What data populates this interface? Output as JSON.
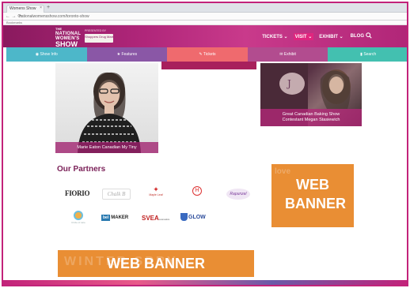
{
  "browser": {
    "tab_title": "Womens Show",
    "tab_close": "×",
    "new_tab": "+",
    "nav_arrows": "← → ⟳",
    "url": "nationalwomensshow.com/toronto-show",
    "bookmarks": "Bookmarks"
  },
  "site": {
    "logo_line1": "THE",
    "logo_line2": "NATIONAL WOMEN'S",
    "logo_line3": "SHOW",
    "sponsor_label": "PRESENTED BY",
    "sponsor_name": "Shoppers Drug Mart",
    "nav": [
      "TICKETS ⌄",
      "VISIT ⌄",
      "EXHIBIT ⌄",
      "BLOG"
    ],
    "active_nav_index": 1,
    "search_icon": "search-icon"
  },
  "menubar": {
    "items": [
      "Show Info",
      "Features",
      "Tickets",
      "Exhibit",
      "Search"
    ]
  },
  "content": {
    "portrait_caption": "Marie Eaton Canadian My Tiny",
    "cake_caption": "Great Canadian Baking Show Contestant Megan Stasiewich",
    "partners_title": "Our Partners"
  },
  "partners": {
    "fiorio": "FIORIO",
    "chalk": "Chalk B",
    "maple": "Maple Leaf",
    "hotel": "H",
    "rapunzel": "Rapunzel",
    "circle_caption": "Circle of care",
    "maker": "MAKER",
    "maker_box": "bel",
    "svea": "SVEA",
    "svea_small": "cosmetics",
    "glow": "GLOW"
  },
  "banners": {
    "banner1": "WEB BANNER",
    "banner2": "WEB BANNER",
    "banner1_ghost": "love",
    "banner2_ghost": "WINTER SPRY"
  },
  "colors": {
    "frame": "#c2237a",
    "brand": "#b0267a",
    "banner": "#e8882a"
  }
}
